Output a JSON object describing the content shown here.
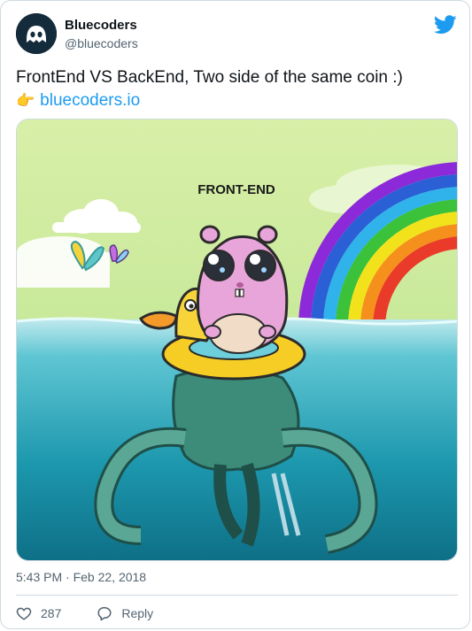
{
  "author": {
    "name": "Bluecoders",
    "handle": "@bluecoders"
  },
  "icons": {
    "platform": "twitter-bird-icon",
    "pointer": "backhand-index-pointing-right",
    "like": "heart-icon",
    "reply": "reply-bubble-icon"
  },
  "tweet": {
    "text": "FrontEnd VS BackEnd, Two side of the same coin :)",
    "pointer_emoji": "👉",
    "link": "bluecoders.io"
  },
  "media": {
    "caption": "FRONT-END"
  },
  "meta": {
    "timestamp": "5:43 PM · Feb 22, 2018"
  },
  "actions": {
    "likes": "287",
    "reply_label": "Reply"
  },
  "colors": {
    "brand": "#1d9bf0",
    "text": "#0f1419",
    "muted": "#536471",
    "border": "#cfd9de"
  }
}
